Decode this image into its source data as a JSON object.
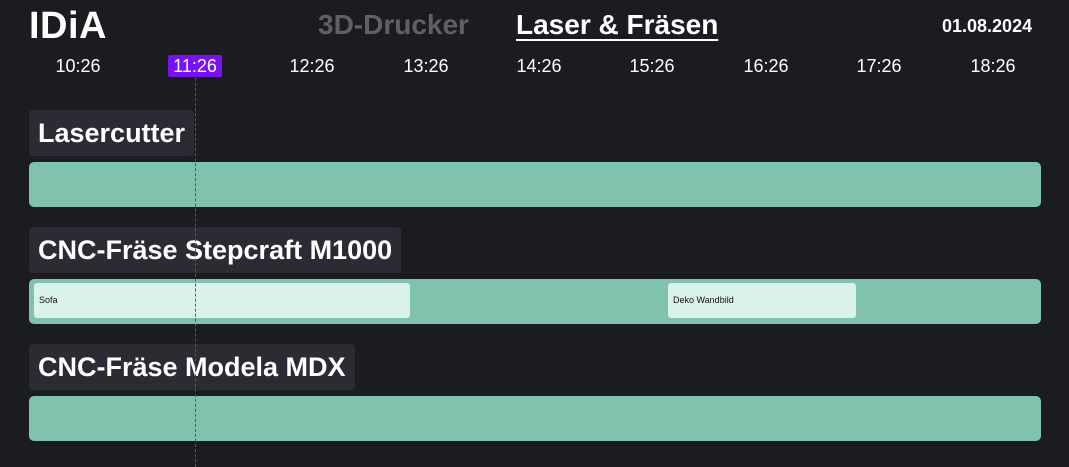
{
  "header": {
    "logo": "IDiA",
    "tabs": [
      {
        "label": "3D-Drucker",
        "active": false
      },
      {
        "label": "Laser & Fräsen",
        "active": true
      }
    ],
    "date": "01.08.2024"
  },
  "timeline": {
    "ticks": [
      "10:26",
      "11:26",
      "12:26",
      "13:26",
      "14:26",
      "15:26",
      "16:26",
      "17:26",
      "18:26"
    ],
    "current": "11:26"
  },
  "machines": [
    {
      "name": "Lasercutter",
      "bookings": []
    },
    {
      "name": "CNC-Fräse Stepcraft M1000",
      "bookings": [
        {
          "label": "Sofa"
        },
        {
          "label": "Deko Wandbild"
        }
      ]
    },
    {
      "name": "CNC-Fräse Modela MDX",
      "bookings": []
    }
  ],
  "colors": {
    "background": "#1b1c20",
    "track": "#7fc2ad",
    "booking": "#daf2ec",
    "current_time": "#7a10f5",
    "label_bg": "#2a2b33"
  }
}
